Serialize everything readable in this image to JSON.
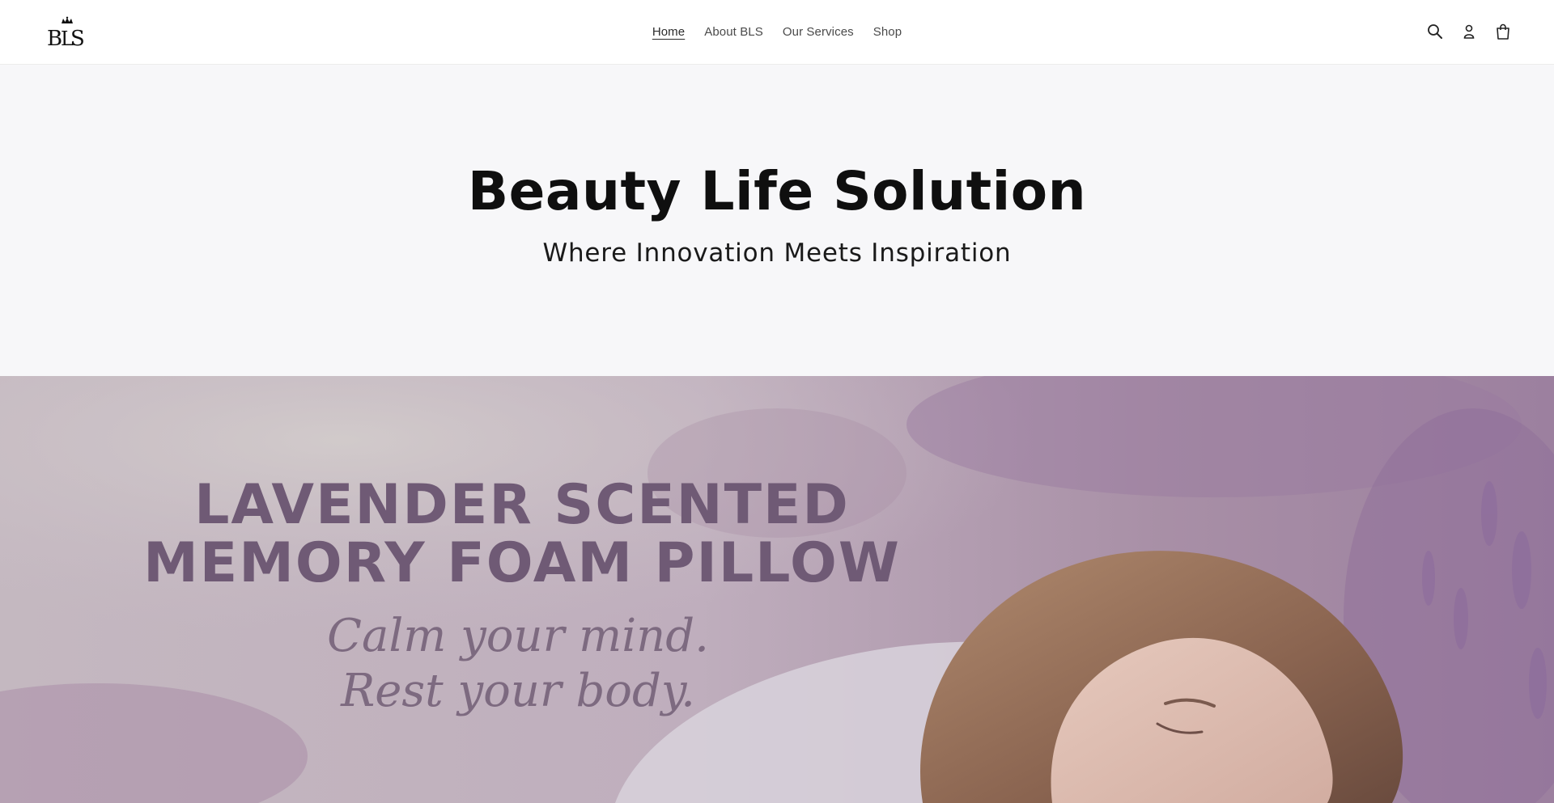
{
  "header": {
    "logo_text": "BLS",
    "nav": [
      {
        "label": "Home",
        "active": true
      },
      {
        "label": "About BLS",
        "active": false
      },
      {
        "label": "Our Services",
        "active": false
      },
      {
        "label": "Shop",
        "active": false
      }
    ],
    "icons": [
      "search-icon",
      "account-icon",
      "cart-icon"
    ]
  },
  "banner": {
    "title": "Beauty Life Solution",
    "subtitle": "Where Innovation Meets Inspiration"
  },
  "hero": {
    "headline_line1": "LAVENDER SCENTED",
    "headline_line2": "MEMORY FOAM PILLOW",
    "tagline_line1": "Calm your mind.",
    "tagline_line2": "Rest your body."
  },
  "colors": {
    "banner_bg": "#f7f7f9",
    "headline": "#6f5a75",
    "tagline": "#7d6a80",
    "lavender": "#9b7fa4"
  }
}
